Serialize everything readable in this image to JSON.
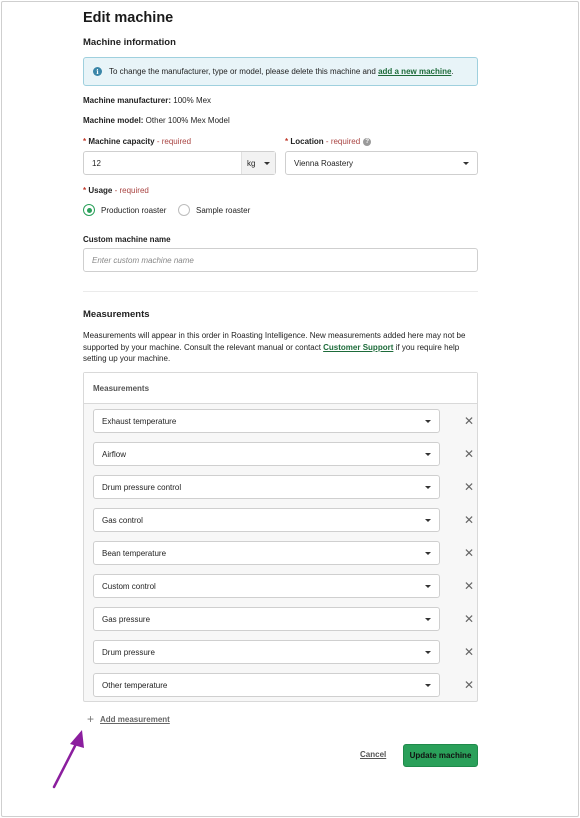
{
  "page_title": "Edit machine",
  "machine_information": {
    "heading": "Machine information",
    "info_text": "To change the manufacturer, type or model, please delete this machine and ",
    "info_link": "add a new machine",
    "info_end": ".",
    "manufacturer_label": "Machine manufacturer:",
    "manufacturer_value": " 100% Mex",
    "model_label": "Machine model:",
    "model_value": " Other 100% Mex Model"
  },
  "capacity": {
    "star": "*",
    "label": "Machine capacity",
    "required": " - required",
    "value": "12",
    "unit": "kg"
  },
  "location": {
    "star": "*",
    "label": "Location",
    "required": " - required",
    "help_icon": "?",
    "value": "Vienna Roastery"
  },
  "usage": {
    "star": "*",
    "label": "Usage",
    "required": " - required",
    "options": [
      "Production roaster",
      "Sample roaster"
    ],
    "selected": "Production roaster"
  },
  "custom_name": {
    "label": "Custom machine name",
    "placeholder": "Enter custom machine name"
  },
  "measurements_section": {
    "heading": "Measurements",
    "paragraph_start": "Measurements will appear in this order in Roasting Intelligence. New measurements added here may not be supported by your machine. Consult the relevant manual or contact ",
    "paragraph_link": "Customer Support",
    "paragraph_end": " if you require help setting up your machine.",
    "table_header": "Measurements",
    "items": [
      "Exhaust temperature",
      "Airflow",
      "Drum pressure control",
      "Gas control",
      "Bean temperature",
      "Custom control",
      "Gas pressure",
      "Drum pressure",
      "Other temperature"
    ],
    "remove_glyph": "✕",
    "add_label": "Add measurement",
    "add_glyph": "+"
  },
  "actions": {
    "cancel": "Cancel",
    "update": "Update machine"
  },
  "colors": {
    "accent_green": "#2aa05a",
    "link_green": "#1d6b3a",
    "info_bg": "#e8f4f8",
    "required_red": "#a94442",
    "annotation_arrow": "#8b1e9e"
  },
  "icons": {
    "info": "info-icon",
    "help": "help-icon",
    "dropdown": "chevron-down-icon",
    "remove": "close-icon",
    "add": "plus-icon"
  }
}
